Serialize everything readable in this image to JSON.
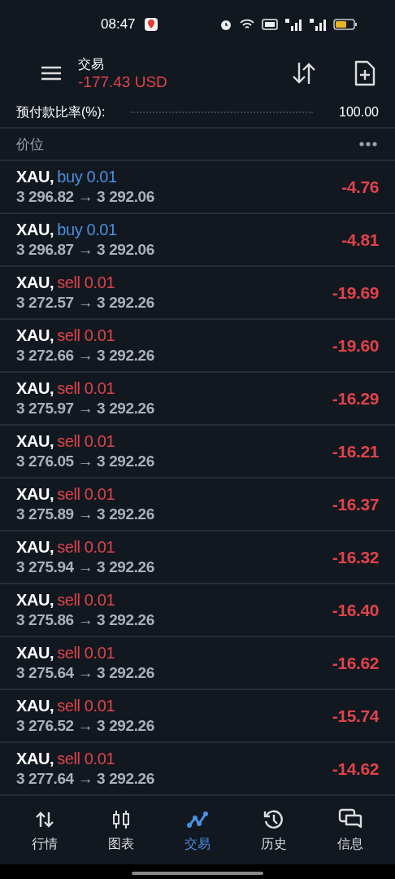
{
  "status_bar": {
    "time": "08:47"
  },
  "header": {
    "title": "交易",
    "balance": "-177.43 USD"
  },
  "summary": {
    "label": "预付款比率(%):",
    "value": "100.00"
  },
  "section": {
    "title": "价位"
  },
  "positions": [
    {
      "symbol": "XAU,",
      "kind": "buy",
      "order": "buy 0.01",
      "prices": "3 296.82 → 3 292.06",
      "profit": "-4.76"
    },
    {
      "symbol": "XAU,",
      "kind": "buy",
      "order": "buy 0.01",
      "prices": "3 296.87 → 3 292.06",
      "profit": "-4.81"
    },
    {
      "symbol": "XAU,",
      "kind": "sell",
      "order": "sell 0.01",
      "prices": "3 272.57 → 3 292.26",
      "profit": "-19.69"
    },
    {
      "symbol": "XAU,",
      "kind": "sell",
      "order": "sell 0.01",
      "prices": "3 272.66 → 3 292.26",
      "profit": "-19.60"
    },
    {
      "symbol": "XAU,",
      "kind": "sell",
      "order": "sell 0.01",
      "prices": "3 275.97 → 3 292.26",
      "profit": "-16.29"
    },
    {
      "symbol": "XAU,",
      "kind": "sell",
      "order": "sell 0.01",
      "prices": "3 276.05 → 3 292.26",
      "profit": "-16.21"
    },
    {
      "symbol": "XAU,",
      "kind": "sell",
      "order": "sell 0.01",
      "prices": "3 275.89 → 3 292.26",
      "profit": "-16.37"
    },
    {
      "symbol": "XAU,",
      "kind": "sell",
      "order": "sell 0.01",
      "prices": "3 275.94 → 3 292.26",
      "profit": "-16.32"
    },
    {
      "symbol": "XAU,",
      "kind": "sell",
      "order": "sell 0.01",
      "prices": "3 275.86 → 3 292.26",
      "profit": "-16.40"
    },
    {
      "symbol": "XAU,",
      "kind": "sell",
      "order": "sell 0.01",
      "prices": "3 275.64 → 3 292.26",
      "profit": "-16.62"
    },
    {
      "symbol": "XAU,",
      "kind": "sell",
      "order": "sell 0.01",
      "prices": "3 276.52 → 3 292.26",
      "profit": "-15.74"
    },
    {
      "symbol": "XAU,",
      "kind": "sell",
      "order": "sell 0.01",
      "prices": "3 277.64 → 3 292.26",
      "profit": "-14.62"
    }
  ],
  "nav": [
    {
      "label": "行情",
      "selected": false
    },
    {
      "label": "图表",
      "selected": false
    },
    {
      "label": "交易",
      "selected": true
    },
    {
      "label": "历史",
      "selected": false
    },
    {
      "label": "信息",
      "selected": false
    }
  ]
}
